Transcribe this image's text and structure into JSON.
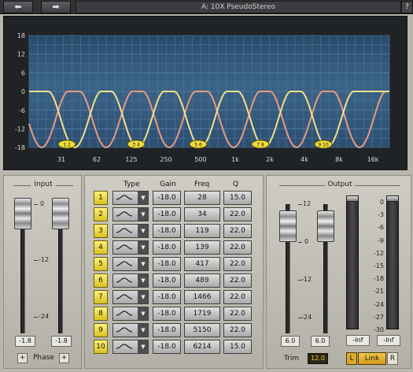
{
  "header": {
    "back_label": "⬅",
    "forward_label": "➡",
    "preset": "A: 10X PseudoStereo",
    "help_label": "?"
  },
  "graph": {
    "y_ticks": [
      "18",
      "12",
      "6",
      "0",
      "-6",
      "-12",
      "-18"
    ],
    "x_ticks": [
      "31",
      "62",
      "125",
      "250",
      "500",
      "1k",
      "2k",
      "4k",
      "8k",
      "16k"
    ],
    "band_markers": [
      "1 2",
      "3 4",
      "5 6",
      "7 8",
      "9 10"
    ]
  },
  "input": {
    "title": "Input",
    "scale": [
      "0",
      "-12",
      "-24"
    ],
    "left_value": "-1.8",
    "right_value": "-1.8",
    "phase_label": "Phase",
    "phase_left": "+",
    "phase_right": "+"
  },
  "bands": {
    "headers": {
      "type": "Type",
      "gain": "Gain",
      "freq": "Freq",
      "q": "Q"
    },
    "rows": [
      {
        "num": "1",
        "gain": "-18.0",
        "freq": "28",
        "q": "15.0"
      },
      {
        "num": "2",
        "gain": "-18.0",
        "freq": "34",
        "q": "22.0"
      },
      {
        "num": "3",
        "gain": "-18.0",
        "freq": "119",
        "q": "22.0"
      },
      {
        "num": "4",
        "gain": "-18.0",
        "freq": "139",
        "q": "22.0"
      },
      {
        "num": "5",
        "gain": "-18.0",
        "freq": "417",
        "q": "22.0"
      },
      {
        "num": "6",
        "gain": "-18.0",
        "freq": "489",
        "q": "22.0"
      },
      {
        "num": "7",
        "gain": "-18.0",
        "freq": "1466",
        "q": "22.0"
      },
      {
        "num": "8",
        "gain": "-18.0",
        "freq": "1719",
        "q": "22.0"
      },
      {
        "num": "9",
        "gain": "-18.0",
        "freq": "5150",
        "q": "22.0"
      },
      {
        "num": "10",
        "gain": "-18.0",
        "freq": "6214",
        "q": "15.0"
      }
    ]
  },
  "output": {
    "title": "Output",
    "scale": [
      "12",
      "0",
      "-12",
      "-24"
    ],
    "left_value": "6.0",
    "right_value": "6.0",
    "trim_label": "Trim",
    "trim_value": "12.0",
    "meter_scale": [
      "0",
      "-3",
      "-6",
      "-9",
      "-12",
      "-15",
      "-18",
      "-21",
      "-24",
      "-27",
      "-30"
    ],
    "meter_left": "-Inf",
    "meter_right": "-Inf",
    "l_label": "L",
    "link_label": "Link",
    "r_label": "R"
  },
  "colors": {
    "curve_yellow": "#f4e08a",
    "curve_salmon": "#e79a83",
    "graph_bg": "#365a7a",
    "band_yellow": "#f0dc3a"
  }
}
